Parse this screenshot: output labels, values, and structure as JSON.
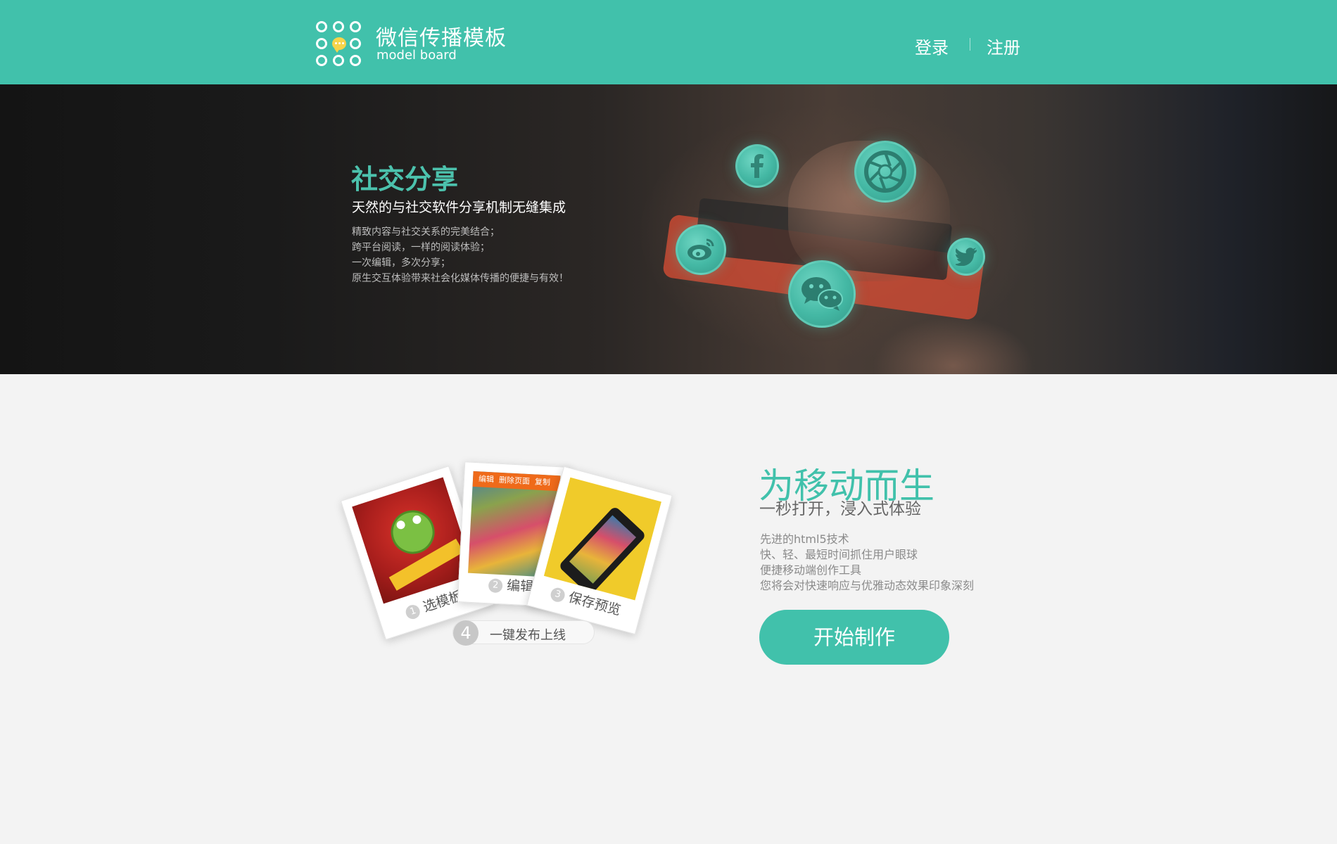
{
  "header": {
    "brand_title": "微信传播模板",
    "brand_subtitle": "model board",
    "login_label": "登录",
    "register_label": "注册"
  },
  "hero": {
    "title": "社交分享",
    "lead": "天然的与社交软件分享机制无缝集成",
    "lines": [
      "精致内容与社交关系的完美结合；",
      "跨平台阅读，一样的阅读体验；",
      "一次编辑，多次分享；",
      "原生交互体验带来社会化媒体传播的便捷与有效！"
    ],
    "icons": [
      "facebook-icon",
      "camera-shutter-icon",
      "weibo-icon",
      "wechat-icon",
      "twitter-icon"
    ]
  },
  "mobile": {
    "title": "为移动而生",
    "subtitle": "一秒打开，浸入式体验",
    "lines": [
      "先进的html5技术",
      "快、轻、最短时间抓住用户眼球",
      "便捷移动端创作工具",
      "您将会对快速响应与优雅动态效果印象深刻"
    ],
    "cta_label": "开始制作",
    "steps": [
      {
        "num": "1",
        "label": "选模板"
      },
      {
        "num": "2",
        "label": "编辑"
      },
      {
        "num": "3",
        "label": "保存预览"
      },
      {
        "num": "4",
        "label": "一键发布上线"
      }
    ],
    "card2_toolbar": [
      "编辑",
      "删除页面",
      "复制"
    ]
  },
  "colors": {
    "brand": "#41c1ab",
    "page_bg": "#f3f3f3"
  }
}
